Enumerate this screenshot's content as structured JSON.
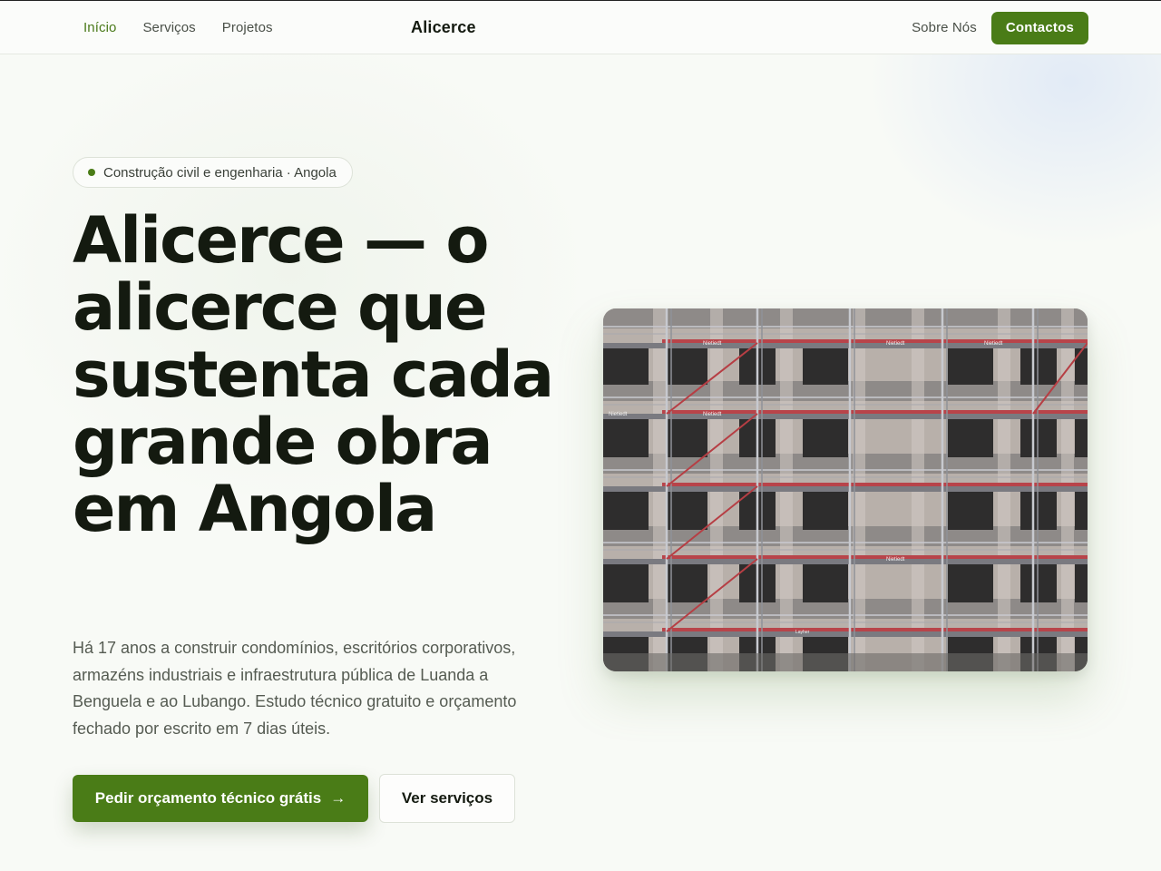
{
  "nav": {
    "links": [
      "Início",
      "Serviços",
      "Projetos"
    ],
    "brand": "Alicerce",
    "about": "Sobre Nós",
    "contact": "Contactos"
  },
  "hero": {
    "tag": "Construção civil e engenharia · Angola",
    "title": "Alicerce — o alicerce que sustenta cada grande obra em Angola",
    "lede": "Há 17 anos a construir condomínios, escritórios corporativos, armazéns industriais e infraestrutura pública de Luanda a Benguela e ao Lubango. Estudo técnico gratuito e orçamento fechado por escrito em 7 dias úteis.",
    "cta_primary": "Pedir orçamento técnico grátis",
    "cta_arrow": "→",
    "cta_secondary": "Ver serviços"
  },
  "image": {
    "scaffold_label": "Nietiedt",
    "scaffold_sublabel": "Layher"
  },
  "colors": {
    "accent": "#4a7c17",
    "active_link": "#4a7a1a",
    "heading": "#141a10",
    "body_text": "#555b52",
    "background": "#f8faf6"
  }
}
